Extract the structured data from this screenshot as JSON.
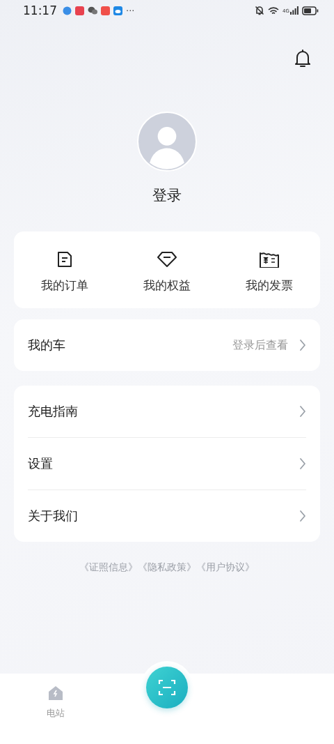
{
  "status_bar": {
    "time": "11:17",
    "more": "···",
    "network": "4G"
  },
  "profile": {
    "login_label": "登录"
  },
  "shortcuts": [
    {
      "kind": "order",
      "label": "我的订单"
    },
    {
      "kind": "benefit",
      "label": "我的权益"
    },
    {
      "kind": "invoice",
      "label": "我的发票"
    }
  ],
  "my_car": {
    "label": "我的车",
    "hint": "登录后查看"
  },
  "menu": [
    {
      "label": "充电指南"
    },
    {
      "label": "设置"
    },
    {
      "label": "关于我们"
    }
  ],
  "legal_links": [
    "《证照信息》",
    "《隐私政策》",
    "《用户协议》"
  ],
  "tab_bar": {
    "tabs": [
      {
        "label": "电站",
        "selected": false
      }
    ]
  }
}
